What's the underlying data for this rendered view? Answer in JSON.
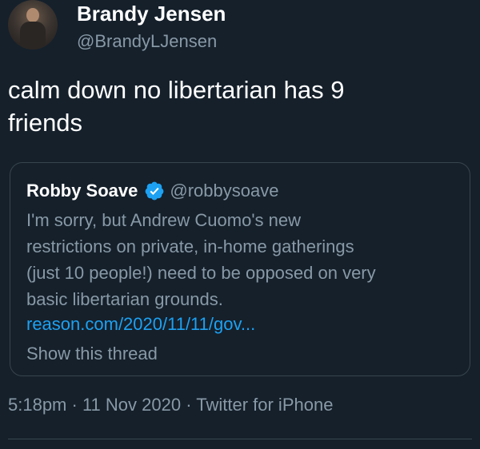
{
  "author": {
    "name": "Brandy Jensen",
    "handle": "@BrandyLJensen"
  },
  "tweet": {
    "text": "calm down no libertarian has 9\nfriends"
  },
  "quoted": {
    "name": "Robby Soave",
    "handle": "@robbysoave",
    "verified_icon": "verified-badge-icon",
    "text_lines": [
      "I'm sorry, but Andrew Cuomo's new",
      "restrictions on private, in-home gatherings",
      "(just 10 people!) need to be opposed on very",
      "basic libertarian grounds."
    ],
    "link": "reason.com/2020/11/11/gov...",
    "show_thread": "Show this thread"
  },
  "meta": {
    "time": "5:18pm",
    "date": "11 Nov 2020",
    "source": "Twitter for iPhone",
    "separator": " · "
  },
  "colors": {
    "background": "#15202b",
    "secondary_text": "#8899a6",
    "link": "#1da1f2",
    "border": "#38444d"
  }
}
